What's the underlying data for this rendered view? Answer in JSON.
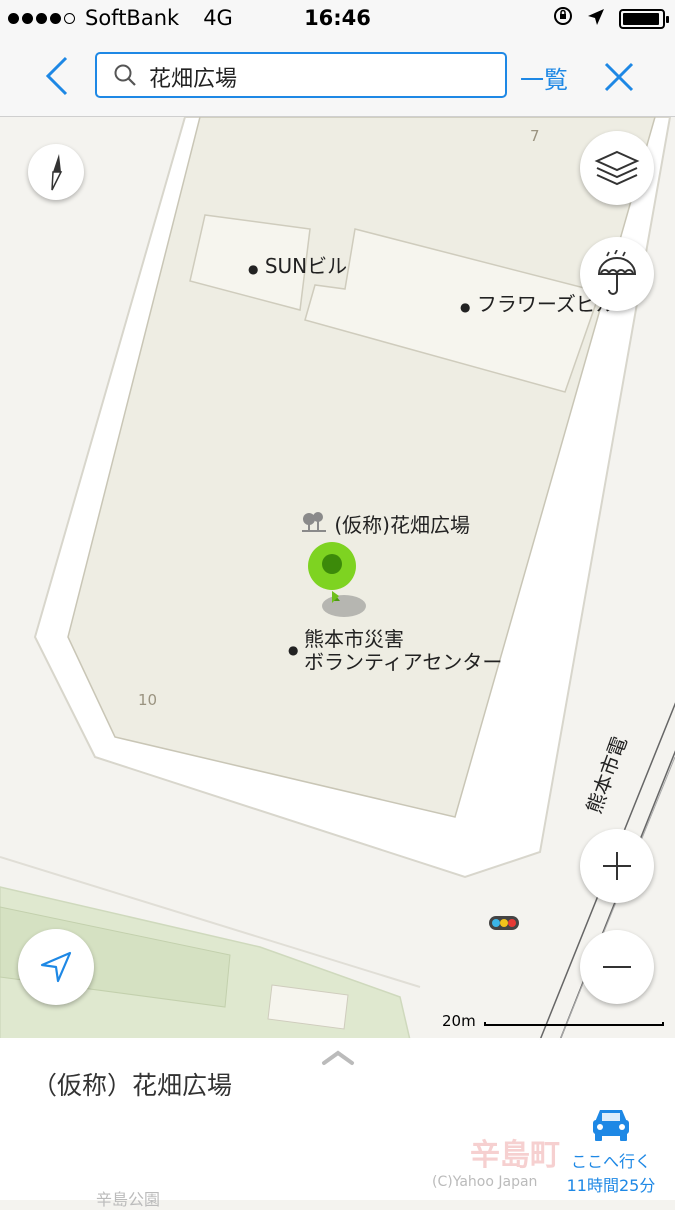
{
  "status_bar": {
    "carrier": "SoftBank",
    "network": "4G",
    "time": "16:46"
  },
  "search": {
    "query": "花畑広場",
    "list_label": "一覧"
  },
  "map": {
    "labels": {
      "sun_building": "SUNビル",
      "flowers_building": "フラワーズビル",
      "plaza": "(仮称)花畑広場",
      "volunteer_center_line1": "熊本市災害",
      "volunteer_center_line2": "ボランティアセンター",
      "tram": "熊本市電"
    },
    "block_numbers": {
      "top": "7",
      "left": "10"
    },
    "scale_label": "20m",
    "colors": {
      "block_fill": "#eeede3",
      "park_fill": "#dfe8cf",
      "pin": "#7ed321",
      "accent": "#1e88e5"
    },
    "icons": [
      "compass-icon",
      "layers-icon",
      "weather-umbrella-icon",
      "zoom-in-icon",
      "zoom-out-icon",
      "locate-me-icon",
      "traffic-light-icon"
    ]
  },
  "bottom_panel": {
    "place_name": "（仮称）花畑広場",
    "go_label": "ここへ行く",
    "duration": "11時間25分",
    "watermark": "辛島町",
    "copyright": "(C)Yahoo Japan",
    "park_label": "辛島公園"
  }
}
